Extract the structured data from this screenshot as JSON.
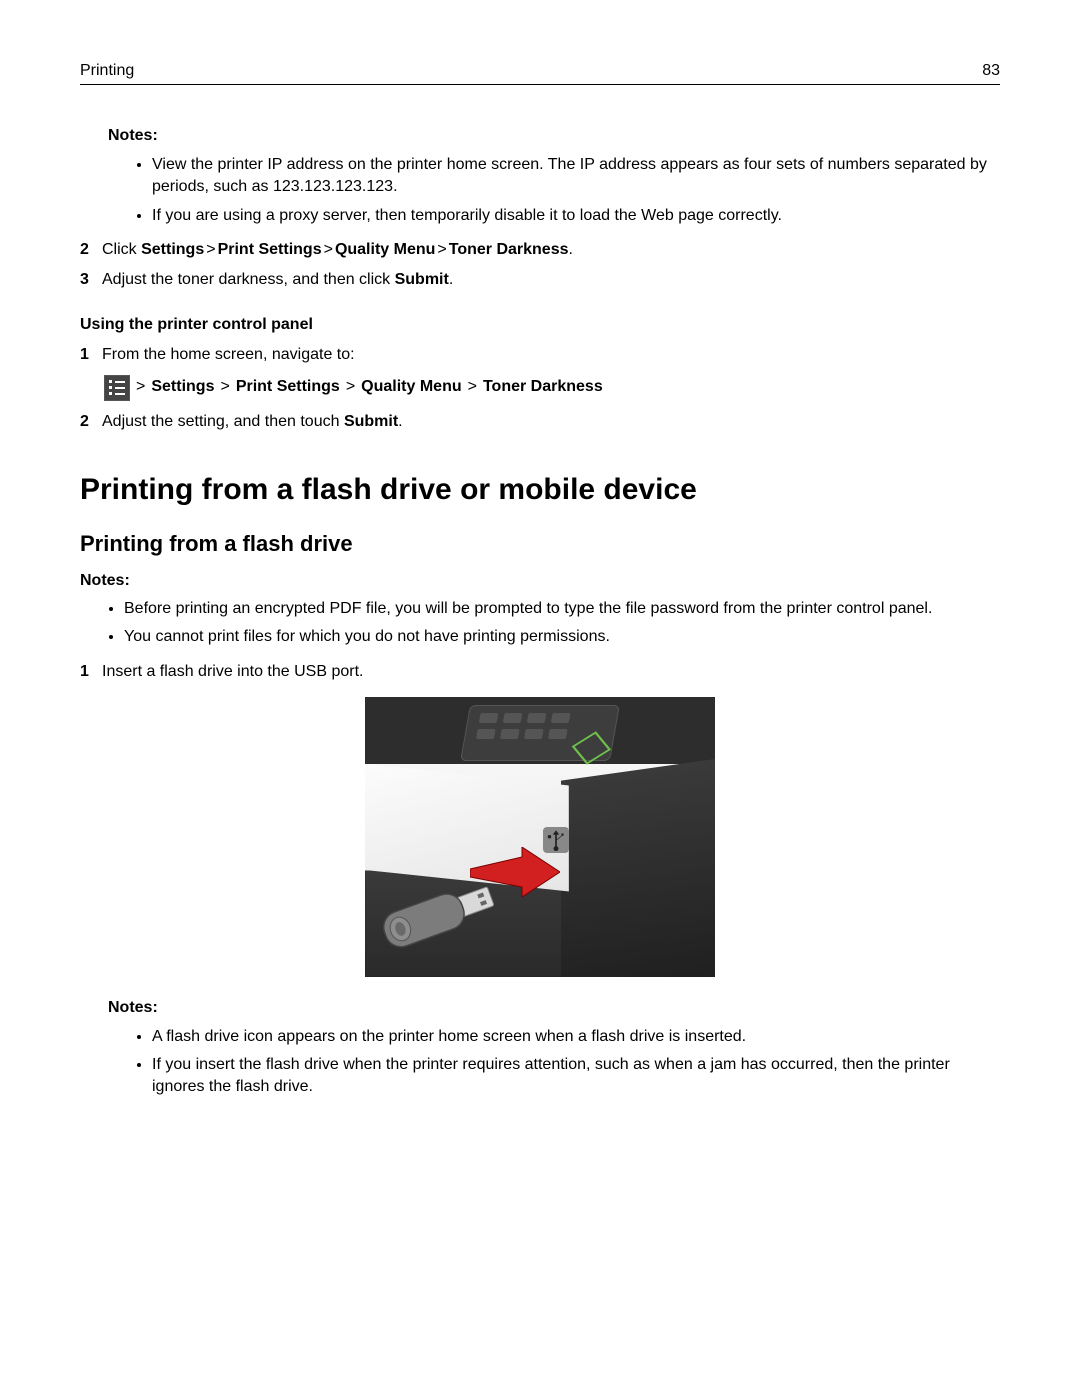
{
  "header": {
    "title": "Printing",
    "page": "83"
  },
  "notes1": {
    "label": "Notes:",
    "items": [
      "View the printer IP address on the printer home screen. The IP address appears as four sets of numbers separated by periods, such as 123.123.123.123.",
      "If you are using a proxy server, then temporarily disable it to load the Web page correctly."
    ]
  },
  "step2": {
    "num": "2",
    "pre": "Click ",
    "path": [
      "Settings",
      "Print Settings",
      "Quality Menu",
      "Toner Darkness"
    ],
    "post": "."
  },
  "step3": {
    "num": "3",
    "pre": "Adjust the toner darkness, and then click ",
    "bold": "Submit",
    "post": "."
  },
  "minor_heading": "Using the printer control panel",
  "cp_step1": {
    "num": "1",
    "text": "From the home screen, navigate to:"
  },
  "cp_nav": {
    "gt": ">",
    "path": [
      "Settings",
      "Print Settings",
      "Quality Menu",
      "Toner Darkness"
    ]
  },
  "cp_step2": {
    "num": "2",
    "pre": "Adjust the setting, and then touch ",
    "bold": "Submit",
    "post": "."
  },
  "section_h1": "Printing from a flash drive or mobile device",
  "subsection_h2": "Printing from a flash drive",
  "notes2": {
    "label": "Notes:",
    "items": [
      "Before printing an encrypted PDF file, you will be prompted to type the file password from the printer control panel.",
      "You cannot print files for which you do not have printing permissions."
    ]
  },
  "fd_step1": {
    "num": "1",
    "text": "Insert a flash drive into the USB port."
  },
  "notes3": {
    "label": "Notes:",
    "items": [
      "A flash drive icon appears on the printer home screen when a flash drive is inserted.",
      "If you insert the flash drive when the printer requires attention, such as when a jam has occurred, then the printer ignores the flash drive."
    ]
  }
}
